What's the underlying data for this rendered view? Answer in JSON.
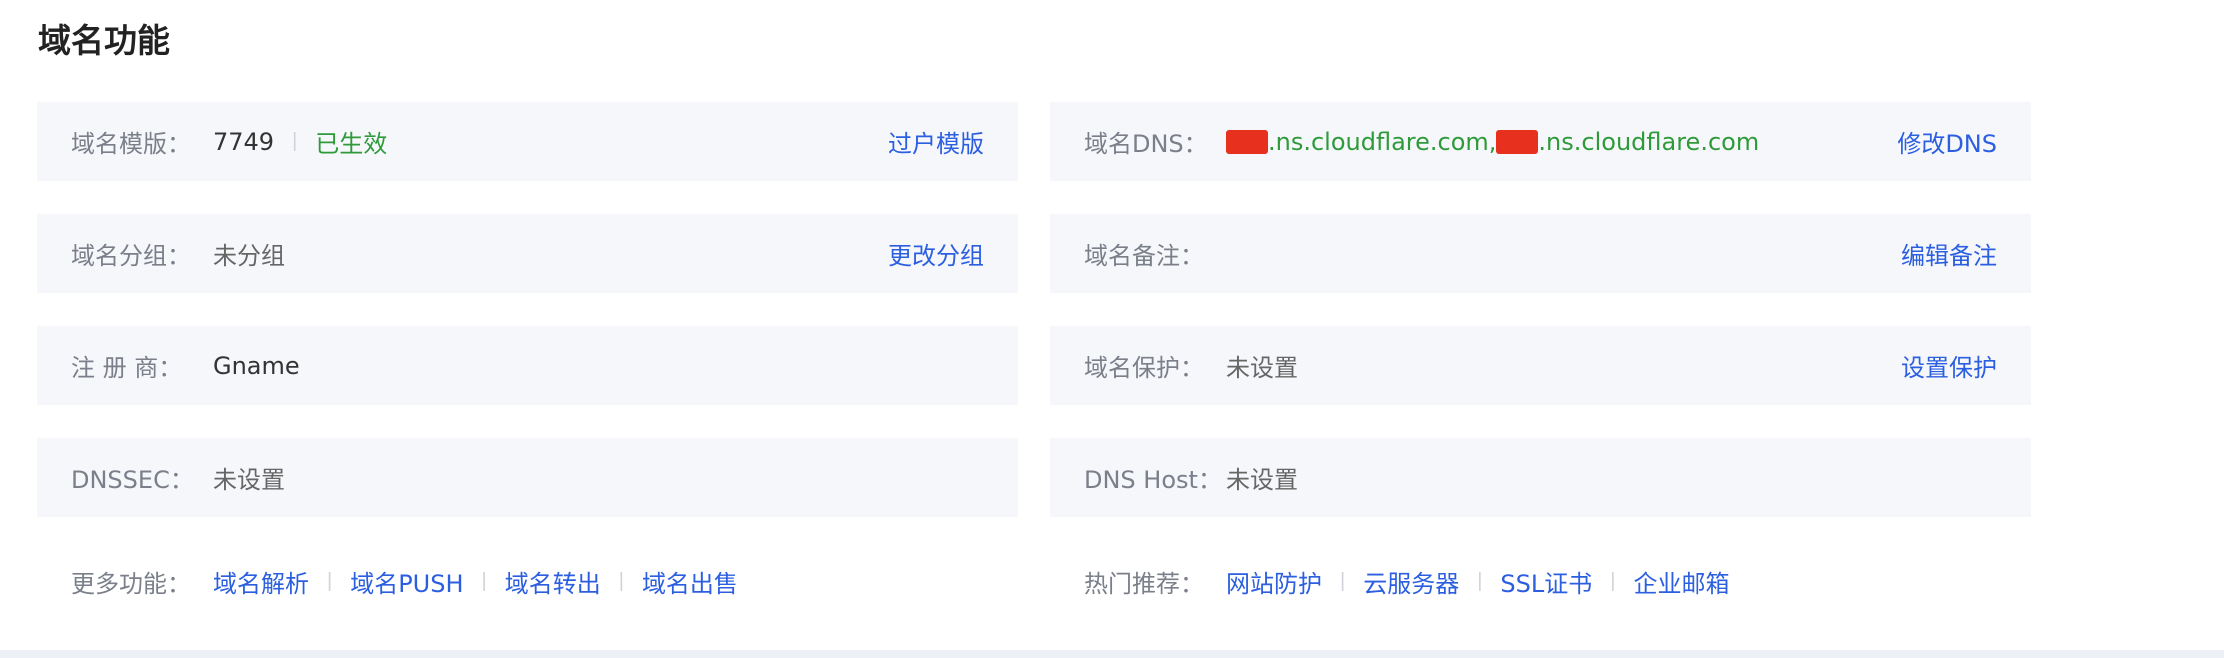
{
  "section_title": "域名功能",
  "left": {
    "template": {
      "label": "域名模版：",
      "value": "7749",
      "status": "已生效",
      "action": "过户模版"
    },
    "group": {
      "label": "域名分组：",
      "value": "未分组",
      "action": "更改分组"
    },
    "registrar": {
      "label": "注 册 商：",
      "value": "Gname"
    },
    "dnssec": {
      "label": "DNSSEC：",
      "value": "未设置"
    },
    "more": {
      "label": "更多功能：",
      "links": [
        "域名解析",
        "域名PUSH",
        "域名转出",
        "域名出售"
      ]
    }
  },
  "right": {
    "dns": {
      "label": "域名DNS：",
      "ns1": ".ns.cloudflare.com,",
      "ns2": ".ns.cloudflare.com",
      "action": "修改DNS"
    },
    "note": {
      "label": "域名备注：",
      "value": "",
      "action": "编辑备注"
    },
    "protect": {
      "label": "域名保护：",
      "value": "未设置",
      "action": "设置保护"
    },
    "dnshost": {
      "label": "DNS Host：",
      "value": "未设置"
    },
    "recommend": {
      "label": "热门推荐：",
      "links": [
        "网站防护",
        "云服务器",
        "SSL证书",
        "企业邮箱"
      ]
    }
  },
  "colors": {
    "link": "#2b5fe0",
    "status_green": "#2e9a3a",
    "row_bg": "#f6f7fb",
    "redaction": "#e8301e"
  }
}
